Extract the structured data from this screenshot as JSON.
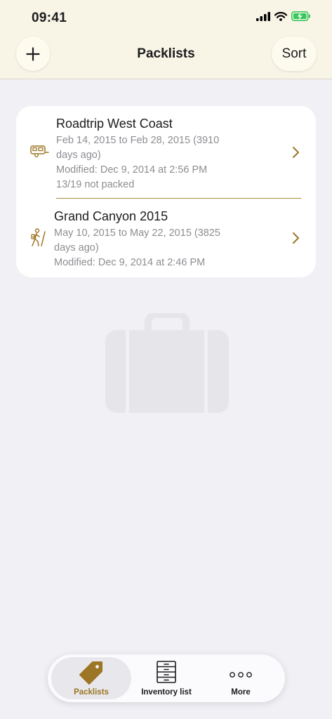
{
  "status_bar": {
    "time": "09:41"
  },
  "header": {
    "title": "Packlists",
    "add_icon": "plus-icon",
    "sort_label": "Sort"
  },
  "trips": [
    {
      "icon": "camper-trailer-icon",
      "title": "Roadtrip West Coast",
      "dates_line1": "Feb 14, 2015 to Feb 28, 2015 (3910",
      "dates_line2": "days ago)",
      "modified": "Modified: Dec 9, 2014 at 2:56 PM",
      "packed_status": "13/19 not packed"
    },
    {
      "icon": "hiker-icon",
      "title": "Grand Canyon 2015",
      "dates_line1": "May 10, 2015 to May 22, 2015 (3825",
      "dates_line2": "days ago)",
      "modified": "Modified: Dec 9, 2014 at 2:46 PM"
    }
  ],
  "empty_state_icon": "suitcase-icon",
  "tab_bar": {
    "tabs": [
      {
        "label": "Packlists",
        "icon": "tag-icon",
        "selected": true
      },
      {
        "label": "Inventory list",
        "icon": "drawer-cabinet-icon",
        "selected": false
      },
      {
        "label": "More",
        "icon": "more-dots-icon",
        "selected": false
      }
    ]
  },
  "colors": {
    "accent": "#9c7624",
    "header_bg": "#f8f4e6",
    "page_bg": "#f1f0f5",
    "battery_green": "#34c759"
  }
}
